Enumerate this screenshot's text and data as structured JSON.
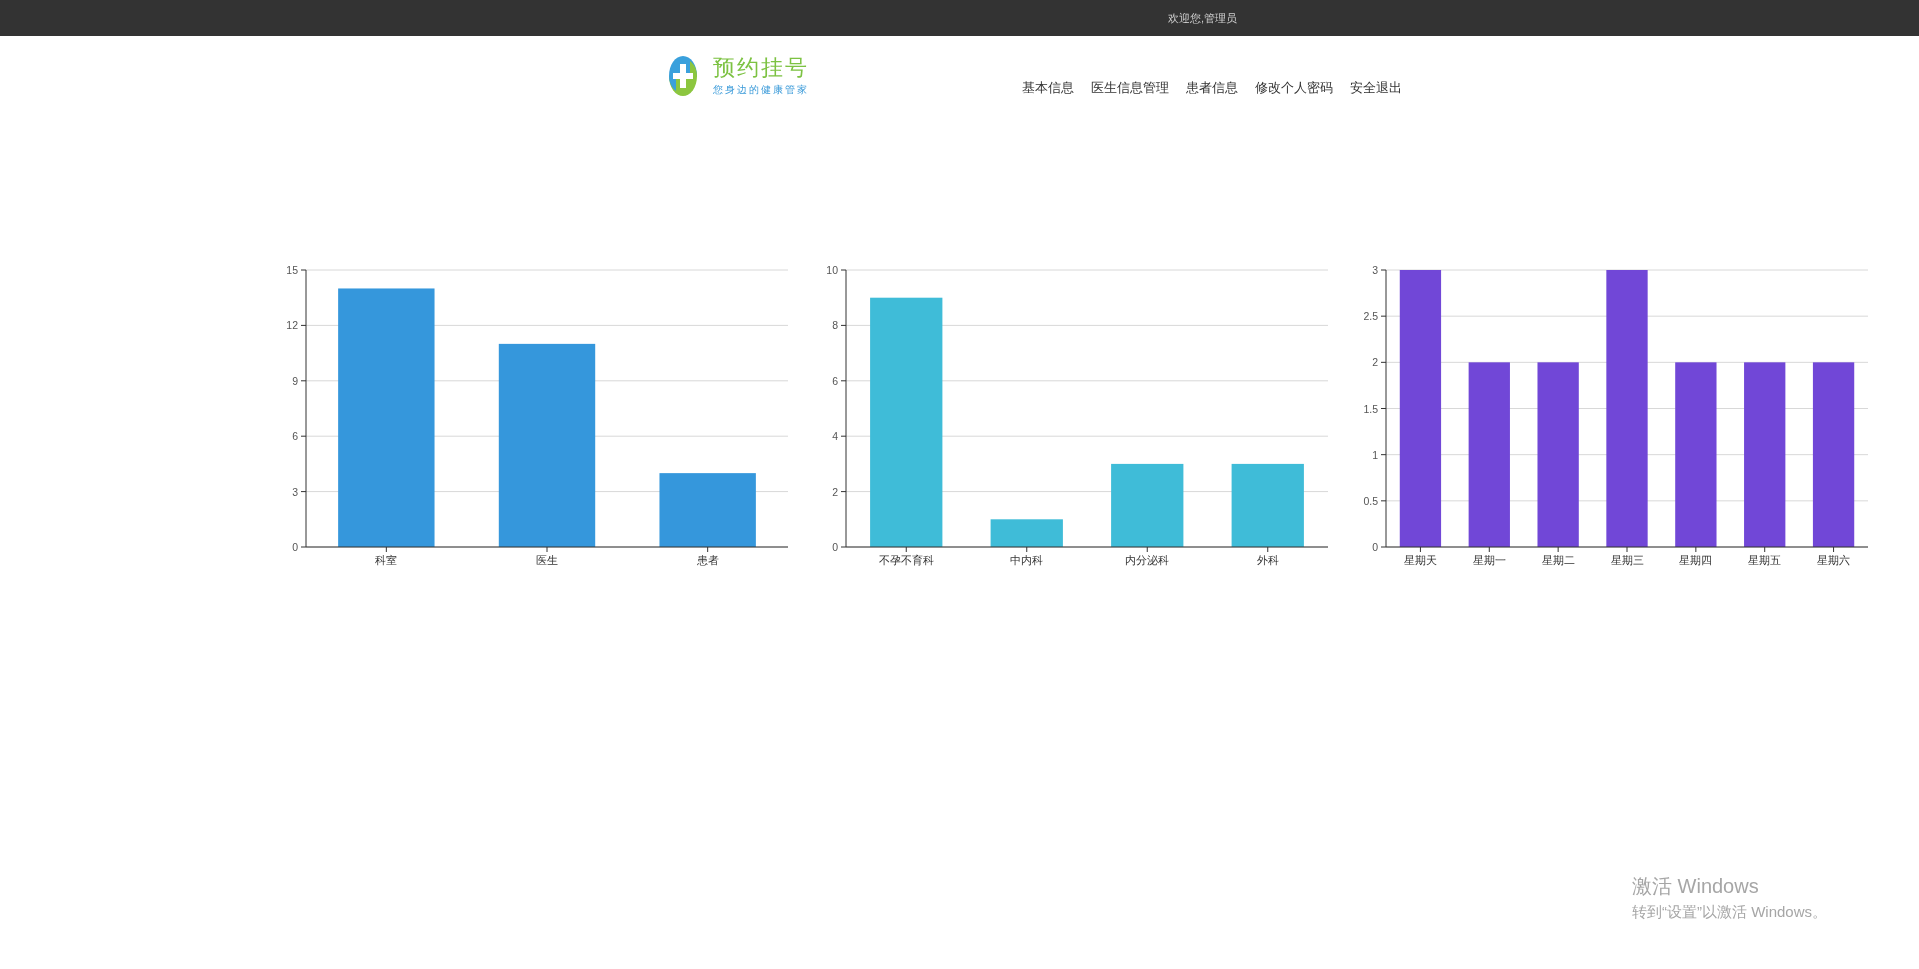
{
  "top_bar": {
    "welcome": "欢迎您,管理员"
  },
  "header": {
    "logo": {
      "title": "预约挂号",
      "slogan": "您身边的健康管家"
    },
    "nav": [
      "基本信息",
      "医生信息管理",
      "患者信息",
      "修改个人密码",
      "安全退出"
    ]
  },
  "charts": [
    {
      "chart_data": {
        "type": "bar",
        "categories": [
          "科室",
          "医生",
          "患者"
        ],
        "series": [
          {
            "color": "#3597dc",
            "values": [
              14,
              11,
              4
            ]
          }
        ],
        "ylim": [
          0,
          15
        ],
        "yticks": [
          0,
          3,
          6,
          9,
          12,
          15
        ],
        "grid": true
      }
    },
    {
      "chart_data": {
        "type": "bar",
        "categories": [
          "不孕不育科",
          "中内科",
          "内分泌科",
          "外科"
        ],
        "series": [
          {
            "color": "#3fbcd8",
            "values": [
              9,
              1,
              3,
              3
            ]
          }
        ],
        "ylim": [
          0,
          10
        ],
        "yticks": [
          0,
          2,
          4,
          6,
          8,
          10
        ],
        "grid": true
      }
    },
    {
      "chart_data": {
        "type": "bar",
        "categories": [
          "星期天",
          "星期一",
          "星期二",
          "星期三",
          "星期四",
          "星期五",
          "星期六"
        ],
        "series": [
          {
            "color": "#7147d7",
            "values": [
              3,
              2,
              2,
              3,
              2,
              2,
              2
            ]
          }
        ],
        "ylim": [
          0,
          3
        ],
        "yticks": [
          0,
          0.5,
          1,
          1.5,
          2,
          2.5,
          3
        ],
        "grid": true
      }
    }
  ],
  "activation_notice": {
    "title": "激活 Windows",
    "hint": "转到“设置”以激活 Windows。"
  }
}
